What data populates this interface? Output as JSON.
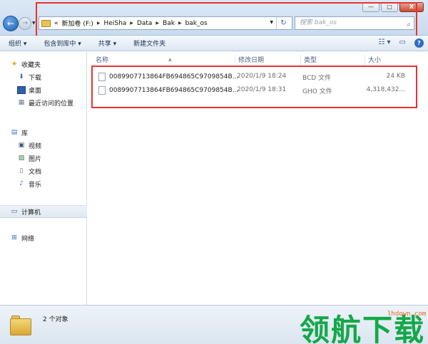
{
  "window": {
    "buttons": {
      "minimize": "—",
      "maximize": "□",
      "close": "X"
    }
  },
  "address_bar": {
    "overflow": "«",
    "segments": [
      "新加卷 (F:)",
      "HeiSha",
      "Data",
      "Bak",
      "bak_os"
    ]
  },
  "search": {
    "placeholder": "搜索 bak_os"
  },
  "toolbar": {
    "organize": "组织 ▾",
    "include_library": "包含到库中 ▾",
    "share": "共享 ▾",
    "new_folder": "新建文件夹"
  },
  "nav": {
    "favorites": "收藏夹",
    "downloads": "下载",
    "desktop": "桌面",
    "recent": "最近访问的位置",
    "libraries": "库",
    "videos": "视频",
    "pictures": "图片",
    "documents": "文档",
    "music": "音乐",
    "computer": "计算机",
    "network": "网络"
  },
  "columns": {
    "name": "名称",
    "modified": "修改日期",
    "type": "类型",
    "size": "大小"
  },
  "files": [
    {
      "name": "0089907713864FB694865C9709854B...",
      "modified": "2020/1/9 18:24",
      "type": "BCD 文件",
      "size": "24 KB"
    },
    {
      "name": "0089907713864FB694865C9709854B...",
      "modified": "2020/1/9 18:31",
      "type": "GHO 文件",
      "size": "4,318,432..."
    }
  ],
  "status": {
    "count": "2 个对象"
  },
  "watermark": {
    "text": "领航下载",
    "site": "lhdown.com"
  },
  "colors": {
    "highlight": "#e8332f",
    "watermark": "#14a84a"
  }
}
